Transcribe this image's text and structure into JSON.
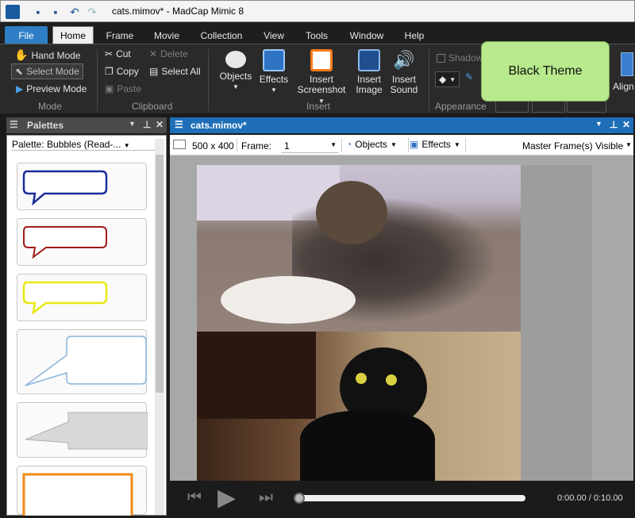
{
  "app": {
    "title": "cats.mimov* - MadCap Mimic 8"
  },
  "tabs": [
    "File",
    "Home",
    "Frame",
    "Movie",
    "Collection",
    "View",
    "Tools",
    "Window",
    "Help"
  ],
  "ribbon": {
    "mode": {
      "hand": "Hand Mode",
      "select": "Select Mode",
      "preview": "Preview Mode",
      "group": "Mode"
    },
    "clipboard": {
      "cut": "Cut",
      "copy": "Copy",
      "paste": "Paste",
      "delete": "Delete",
      "select_all": "Select All",
      "group": "Clipboard"
    },
    "insert": {
      "objects": "Objects",
      "effects": "Effects",
      "screenshot_l1": "Insert",
      "screenshot_l2": "Screenshot",
      "image_l1": "Insert",
      "image_l2": "Image",
      "sound_l1": "Insert",
      "sound_l2": "Sound",
      "group": "Insert"
    },
    "appearance": {
      "shadow": "Shadow",
      "group": "Appearance"
    },
    "align_partial": "Align"
  },
  "tooltip": {
    "text": "Black Theme"
  },
  "palettes": {
    "title": "Palettes",
    "dropdown": "Palette: Bubbles (Read-..."
  },
  "document": {
    "tab_title": "cats.mimov*",
    "size": "500 x 400",
    "frame_label": "Frame:",
    "frame_value": "1",
    "objects": "Objects",
    "effects": "Effects",
    "master": "Master Frame(s) Visible"
  },
  "player": {
    "time": "0:00.00 / 0:10.00",
    "progress": 0.0
  }
}
